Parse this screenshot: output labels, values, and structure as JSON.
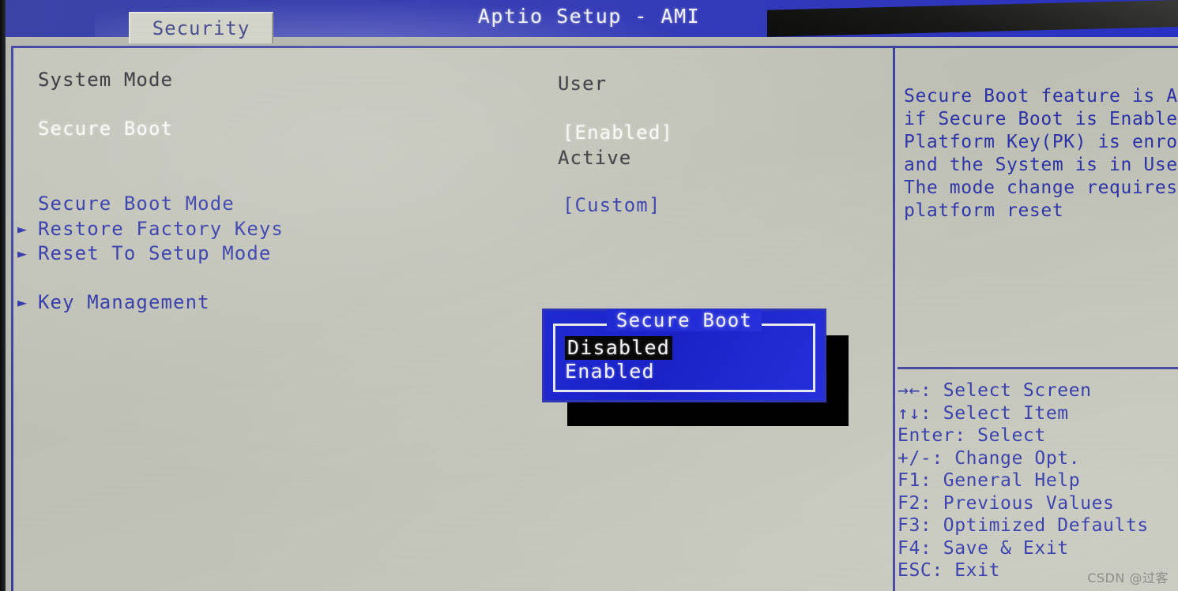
{
  "header": {
    "title": "Aptio Setup - AMI",
    "active_tab": "Security",
    "accent_blue": "#2b31a8",
    "header_bg": "#3a41b4",
    "panel_bg": "#c4c6bb",
    "tab_bg": "#d6d7ca"
  },
  "settings": [
    {
      "label": "System Mode",
      "value": "User",
      "arrow": false,
      "label_style": "dark",
      "value_style": "dark"
    },
    {
      "label": "Secure Boot",
      "value": "[Enabled]",
      "arrow": false,
      "label_style": "white",
      "value_style": "white"
    },
    {
      "label": "",
      "value": "Active",
      "arrow": false,
      "label_style": "dark",
      "value_style": "dark"
    },
    {
      "label": "Secure Boot Mode",
      "value": "[Custom]",
      "arrow": false,
      "label_style": "blue",
      "value_style": "blue"
    },
    {
      "label": "Restore Factory Keys",
      "value": "",
      "arrow": true,
      "label_style": "blue",
      "value_style": "blue"
    },
    {
      "label": "Reset To Setup Mode",
      "value": "",
      "arrow": true,
      "label_style": "blue",
      "value_style": "blue"
    },
    {
      "label": "Key Management",
      "value": "",
      "arrow": true,
      "label_style": "blue",
      "value_style": "blue"
    }
  ],
  "help": {
    "description": "Secure Boot feature is Active\nif Secure Boot is Enabled,\nPlatform Key(PK) is enrolled\nand the System is in User mode.\nThe mode change requires\nplatform reset",
    "keys": "→←: Select Screen\n↑↓: Select Item\nEnter: Select\n+/-: Change Opt.\nF1: General Help\nF2: Previous Values\nF3: Optimized Defaults\nF4: Save & Exit\nESC: Exit"
  },
  "popup": {
    "title": "Secure Boot",
    "options": [
      "Disabled",
      "Enabled"
    ],
    "selected": "Disabled",
    "bg": "#1f2ad4",
    "selected_bg": "#070708"
  },
  "watermark": "CSDN @过客"
}
